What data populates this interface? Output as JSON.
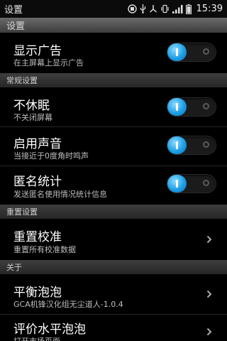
{
  "status_bar": {
    "title": "设置",
    "time": "15:39",
    "icons": [
      "sync-icon",
      "usb-icon",
      "share-icon",
      "vibrate-icon",
      "signal-icon",
      "battery-icon"
    ]
  },
  "header": {
    "title": "设置"
  },
  "toggle_color": "#1d9ee6",
  "items": {
    "show_ads": {
      "title": "显示广告",
      "subtitle": "在主屏幕上显示广告",
      "enabled": true
    },
    "section_general": "常规设置",
    "no_sleep": {
      "title": "不休眠",
      "subtitle": "不关闭屏幕",
      "enabled": true
    },
    "sound": {
      "title": "启用声音",
      "subtitle": "当接近于0度角时鸣声",
      "enabled": true
    },
    "anon_stats": {
      "title": "匿名统计",
      "subtitle": "发送匿名使用情况统计信息",
      "enabled": true
    },
    "section_reset": "重置设置",
    "reset_calib": {
      "title": "重置校准",
      "subtitle": "重置所有校准数据"
    },
    "section_about": "关于",
    "about_app": {
      "title": "平衡泡泡",
      "subtitle": "GCA机锋汉化组无尘道人-1.0.4"
    },
    "rate_app": {
      "title": "评价水平泡泡",
      "subtitle": "打开市场页面"
    }
  }
}
